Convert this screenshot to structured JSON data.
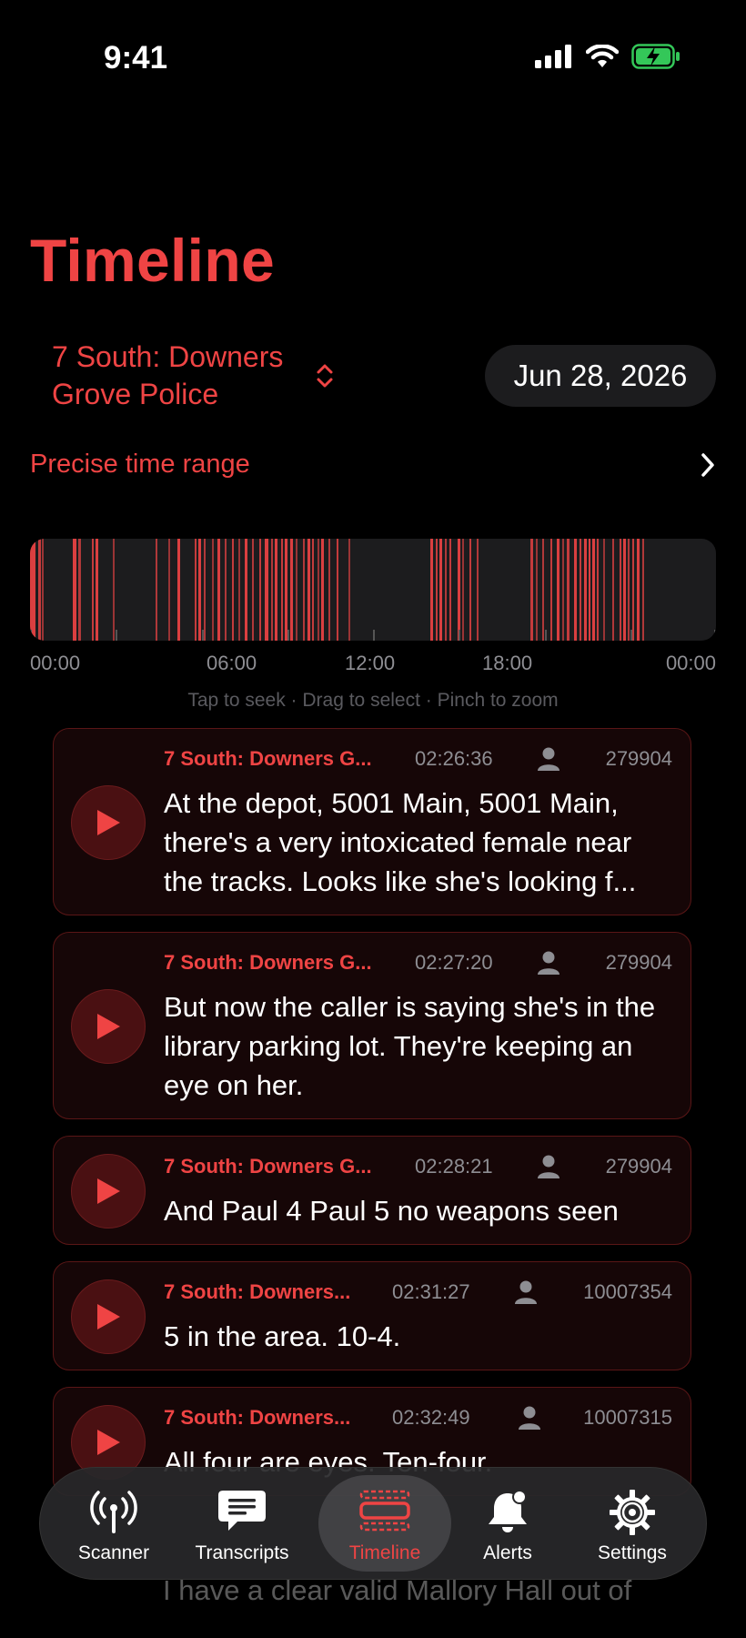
{
  "status_bar": {
    "time": "9:41"
  },
  "page": {
    "title": "Timeline"
  },
  "channel_selector": {
    "label": "7 South: Downers Grove Police"
  },
  "date_picker": {
    "value": "Jun 28, 2026"
  },
  "precise_range": {
    "label": "Precise time range"
  },
  "timeline": {
    "axis_labels": [
      "00:00",
      "06:00",
      "12:00",
      "18:00",
      "00:00"
    ],
    "hint": "Tap to seek · Drag to select · Pinch to zoom",
    "activity_color": "#ef4444"
  },
  "transcripts": [
    {
      "channel": "7 South: Downers G...",
      "time": "02:26:36",
      "unit": "279904",
      "text": "At the depot, 5001 Main, 5001 Main, there's a very intoxicated female near the tracks. Looks like she's looking f..."
    },
    {
      "channel": "7 South: Downers G...",
      "time": "02:27:20",
      "unit": "279904",
      "text": "But now the caller is saying she's in the library parking lot. They're keeping an eye on her."
    },
    {
      "channel": "7 South: Downers G...",
      "time": "02:28:21",
      "unit": "279904",
      "text": "And Paul 4 Paul 5 no weapons seen"
    },
    {
      "channel": "7 South: Downers...",
      "time": "02:31:27",
      "unit": "10007354",
      "text": "5 in the area. 10-4."
    },
    {
      "channel": "7 South: Downers...",
      "time": "02:32:49",
      "unit": "10007315",
      "text": "All four are eyes. Ten-four."
    }
  ],
  "under_nav_text": "I have a clear valid Mallory Hall out of",
  "nav": {
    "items": [
      {
        "label": "Scanner",
        "icon": "antenna-icon"
      },
      {
        "label": "Transcripts",
        "icon": "chat-bubble-icon"
      },
      {
        "label": "Timeline",
        "icon": "timeline-icon"
      },
      {
        "label": "Alerts",
        "icon": "bell-icon"
      },
      {
        "label": "Settings",
        "icon": "gear-icon"
      }
    ],
    "active": "Timeline"
  },
  "colors": {
    "accent": "#ef4444",
    "background": "#000000",
    "card": "#160607",
    "card_border": "#5a1616"
  }
}
